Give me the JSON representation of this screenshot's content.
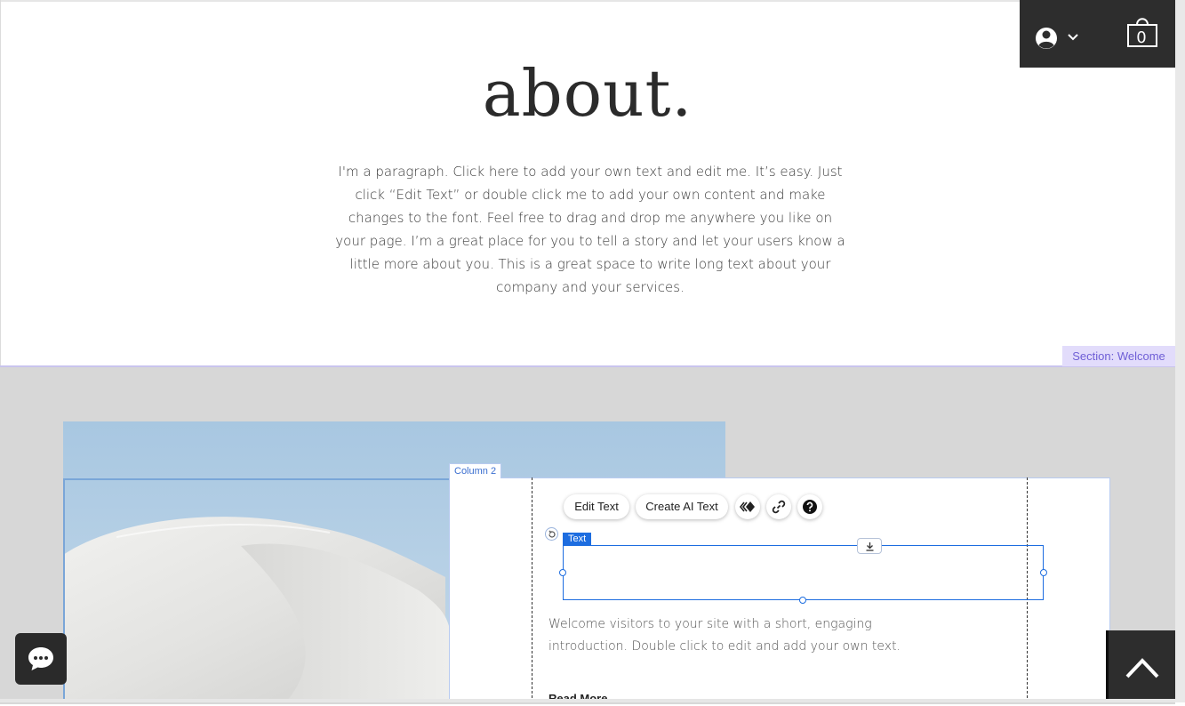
{
  "header": {
    "login_icon": "user-avatar-icon",
    "dropdown_icon": "chevron-down-icon",
    "cart_icon": "shopping-bag-icon",
    "cart_count": "0"
  },
  "about": {
    "title": "about.",
    "paragraph": "I'm a paragraph. Click here to add your own text and edit me. It’s easy. Just click “Edit Text” or double click me to add your own content and make changes to the font. Feel free to drag and drop me anywhere you like on your page. I’m a great place for you to tell a story and let your users know a little more about you. This is a great space to write long text about your company and your services."
  },
  "editor": {
    "section_label": "Section: Welcome",
    "column_label": "Column 2",
    "selected_element_label": "Text",
    "toolbar": {
      "edit_text": "Edit Text",
      "create_ai_text": "Create AI Text",
      "animation_icon": "animation-icon",
      "link_icon": "link-icon",
      "help_icon": "help-icon"
    }
  },
  "welcome": {
    "intro_text": "Welcome visitors to your site with a short, engaging introduction. Double click to edit and add your own text.",
    "read_more": "Read More"
  },
  "widgets": {
    "chat_icon": "chat-bubble-icon",
    "back_to_top_icon": "chevron-up-icon"
  },
  "colors": {
    "header_bg": "#2d2d2d",
    "section_bg": "#d7d7d7",
    "selection_blue": "#1d6de0",
    "section_label_bg": "#e2dcfb",
    "section_label_text": "#6f5fd6"
  }
}
